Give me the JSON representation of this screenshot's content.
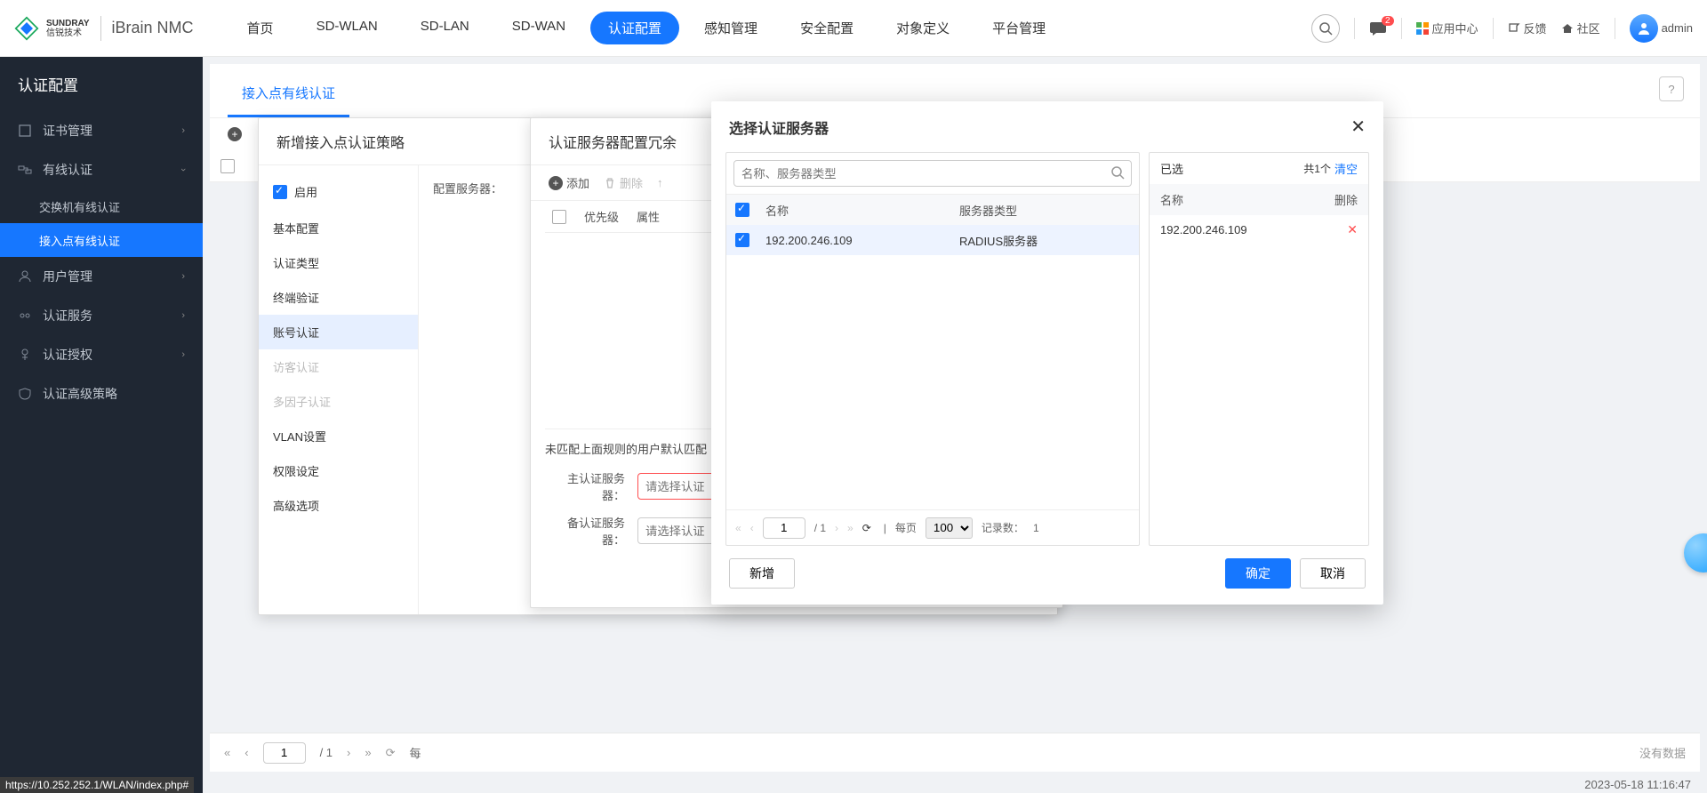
{
  "header": {
    "brand": "SUNDRAY",
    "brand_cn": "信锐技术",
    "product": "iBrain NMC",
    "nav": [
      "首页",
      "SD-WLAN",
      "SD-LAN",
      "SD-WAN",
      "认证配置",
      "感知管理",
      "安全配置",
      "对象定义",
      "平台管理"
    ],
    "active_nav_index": 4,
    "badge_count": "2",
    "app_center": "应用中心",
    "feedback": "反馈",
    "community": "社区",
    "user": "admin"
  },
  "sidebar": {
    "title": "认证配置",
    "items": [
      {
        "label": "证书管理",
        "open": false
      },
      {
        "label": "有线认证",
        "open": true,
        "subs": [
          "交换机有线认证",
          "接入点有线认证"
        ],
        "active_sub": 1
      },
      {
        "label": "用户管理",
        "open": false
      },
      {
        "label": "认证服务",
        "open": false
      },
      {
        "label": "认证授权",
        "open": false
      },
      {
        "label": "认证高级策略",
        "open": false,
        "noChevron": true
      }
    ]
  },
  "tabs": {
    "active": "接入点有线认证"
  },
  "grid": {
    "no_data": "没有数据"
  },
  "policy_modal": {
    "title": "新增接入点认证策略",
    "enable_label": "启用",
    "nav": [
      {
        "label": "基本配置",
        "disabled": false
      },
      {
        "label": "认证类型",
        "disabled": false
      },
      {
        "label": "终端验证",
        "disabled": false
      },
      {
        "label": "账号认证",
        "disabled": false,
        "active": true
      },
      {
        "label": "访客认证",
        "disabled": true
      },
      {
        "label": "多因子认证",
        "disabled": true
      },
      {
        "label": "VLAN设置",
        "disabled": false
      },
      {
        "label": "权限设定",
        "disabled": false
      },
      {
        "label": "高级选项",
        "disabled": false
      }
    ],
    "field_label": "配置服务器："
  },
  "redun_modal": {
    "title": "认证服务器配置冗余",
    "add": "添加",
    "delete": "删除",
    "th": [
      "优先级",
      "属性"
    ],
    "section_title": "未匹配上面规则的用户默认匹配",
    "f1_label": "主认证服务器：",
    "f1_placeholder": "请选择认证",
    "f2_label": "备认证服务器：",
    "f2_placeholder": "请选择认证"
  },
  "selector_modal": {
    "title": "选择认证服务器",
    "search_placeholder": "名称、服务器类型",
    "th_name": "名称",
    "th_type": "服务器类型",
    "row_name": "192.200.246.109",
    "row_type": "RADIUS服务器",
    "right_title": "已选",
    "count_prefix": "共",
    "count_suffix": "个",
    "count": "1",
    "clear": "清空",
    "right_th_name": "名称",
    "right_th_del": "删除",
    "pager": {
      "page": "1",
      "total": "/ 1",
      "per_label": "每页",
      "per": "100",
      "rec_label": "记录数：",
      "rec": "1"
    },
    "btn_new": "新增",
    "btn_ok": "确定",
    "btn_cancel": "取消"
  },
  "bottom_pager": {
    "page": "1",
    "total": "/ 1",
    "per_label": "每"
  },
  "status_time": "2023-05-18 11:16:47",
  "corner_url": "https://10.252.252.1/WLAN/index.php#"
}
